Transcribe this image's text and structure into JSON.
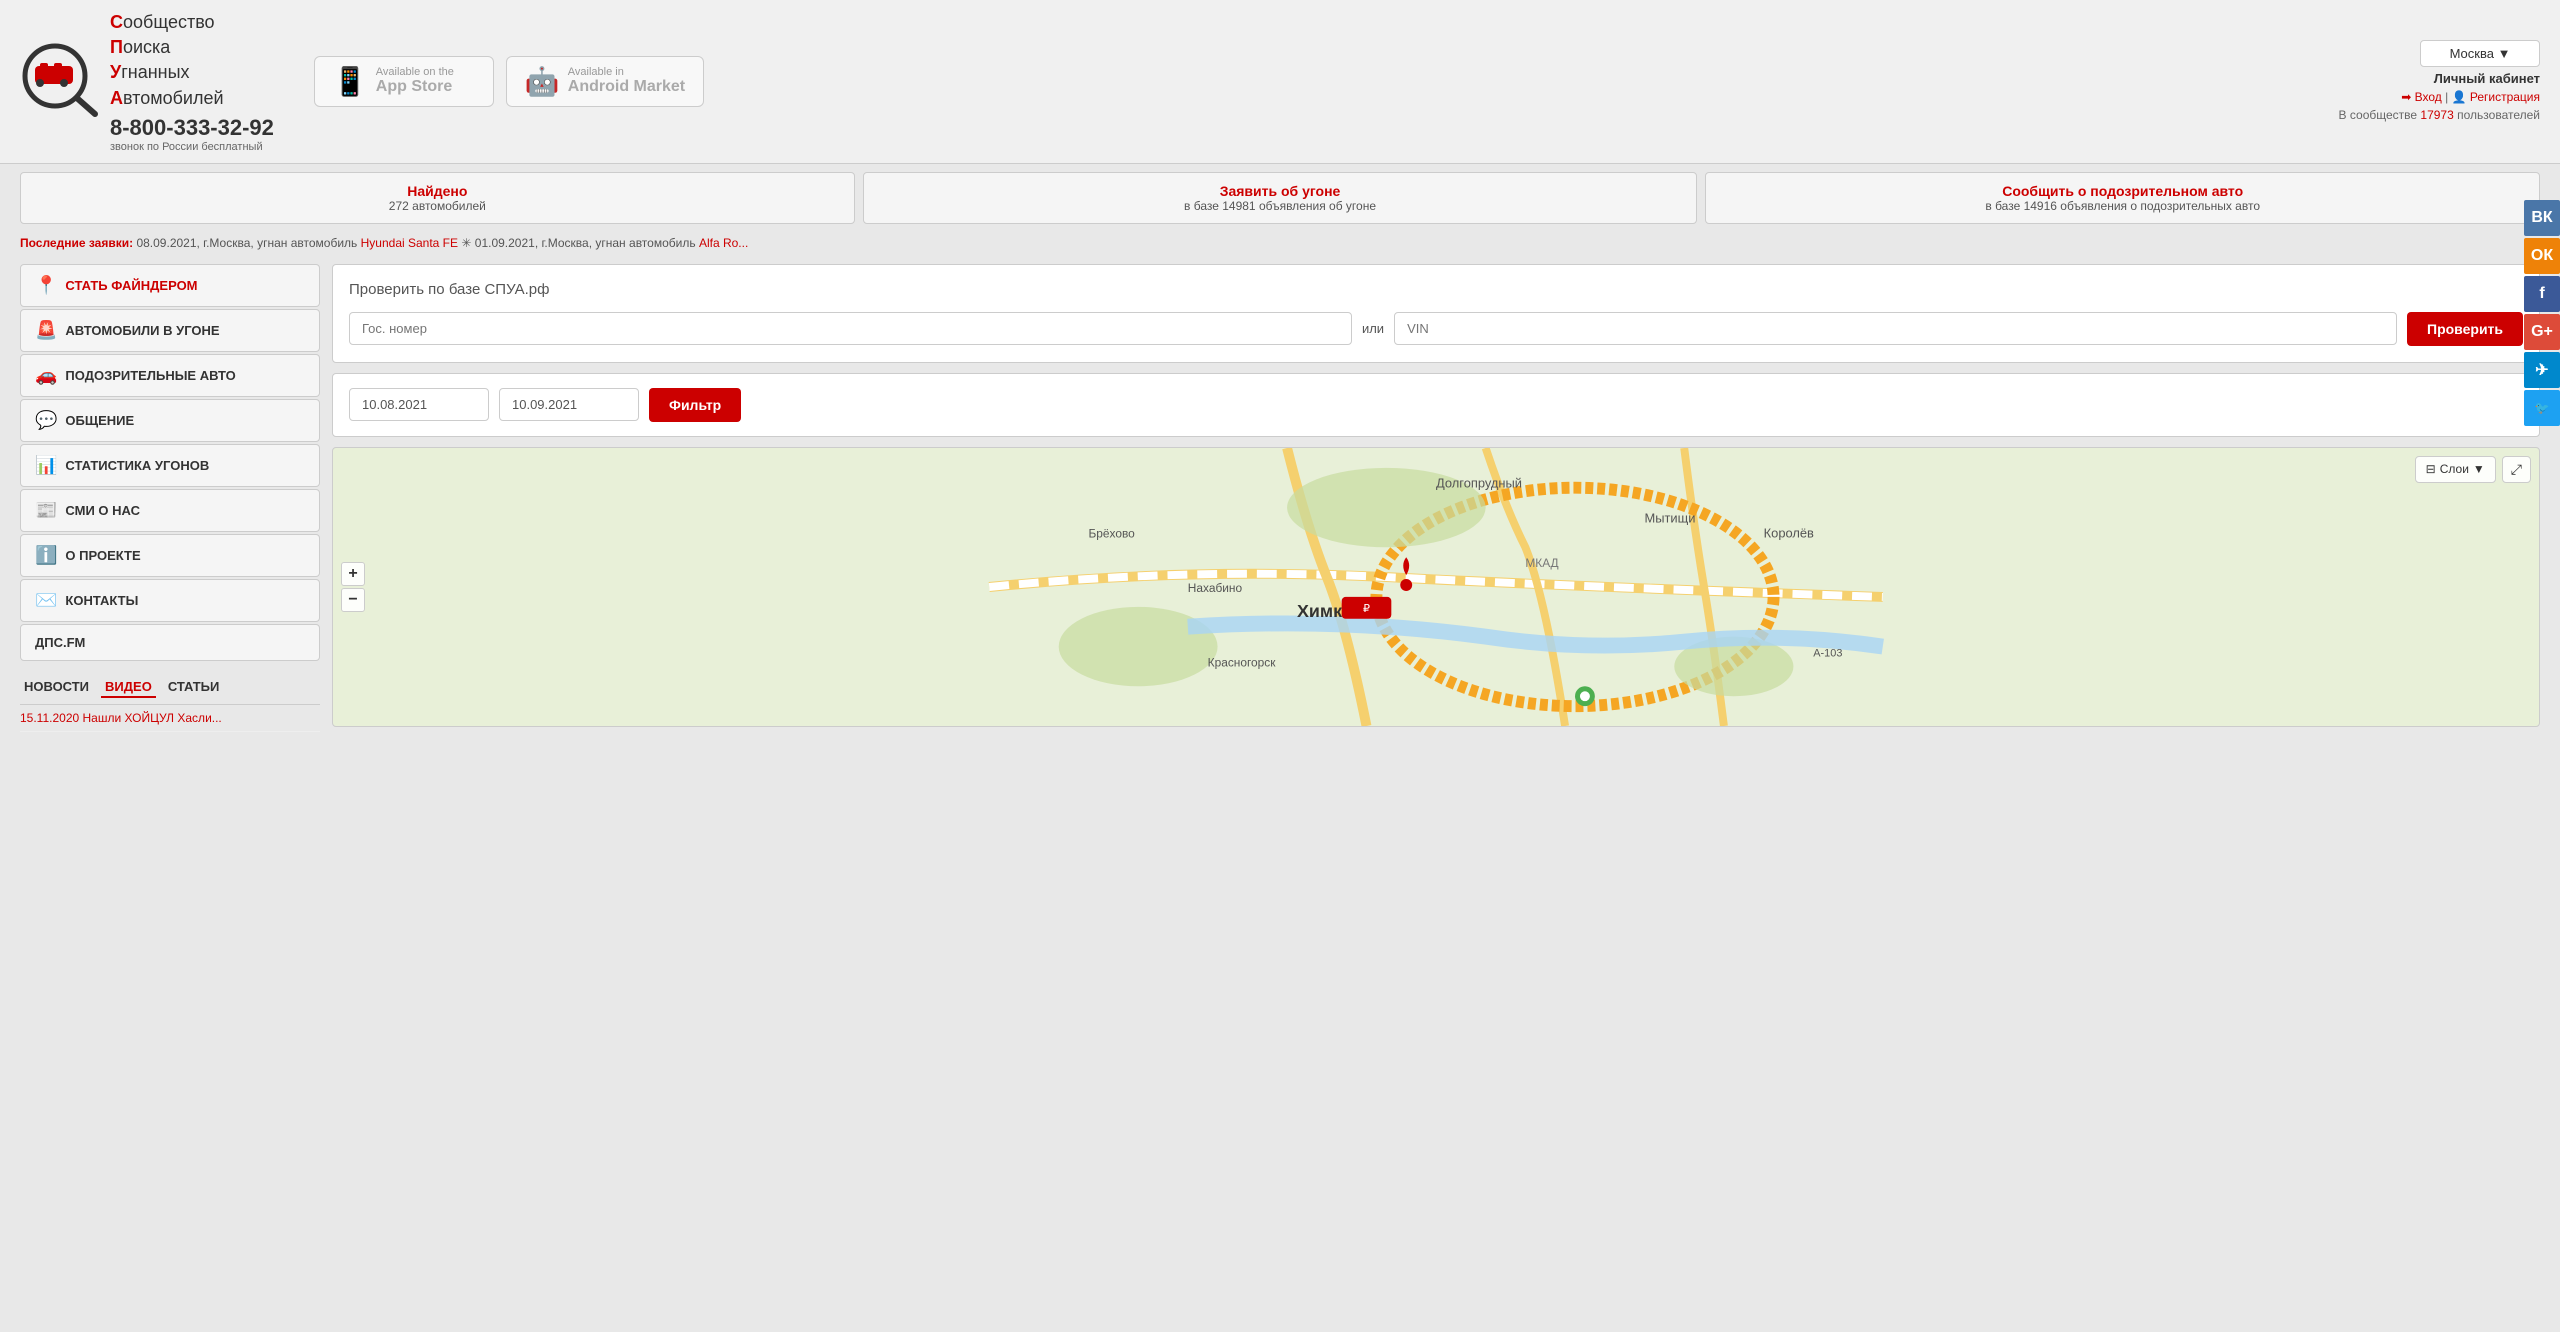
{
  "header": {
    "logo_alt": "СПУА Logo",
    "brand_line1": "С",
    "brand_rest1": "ообщество",
    "brand_line2": "П",
    "brand_rest2": "оиска",
    "brand_line3": "У",
    "brand_rest3": "гнанных",
    "brand_line4": "А",
    "brand_rest4": "втомобилей",
    "phone": "8-800-333-32-92",
    "phone_note": "звонок по России бесплатный",
    "app_store_top": "Available on the",
    "app_store_bottom": "App Store",
    "android_top": "Available in",
    "android_bottom": "Android Market",
    "city": "Москва",
    "personal_area": "Личный кабинет",
    "login": "Вход",
    "register": "Регистрация",
    "community_text": "В сообществе",
    "community_count": "17973",
    "community_suffix": "пользователей"
  },
  "stats": {
    "found_title": "Найдено",
    "found_value": "272 автомобилей",
    "report_title": "Заявить об угоне",
    "report_sub": "в базе 14981 объявления об угоне",
    "suspicious_title": "Сообщить о подозрительном авто",
    "suspicious_sub": "в базе 14916 объявления о подозрительных авто"
  },
  "ticker": {
    "label": "Последние заявки:",
    "text1": "08.09.2021, г.Москва, угнан автомобиль",
    "car1": "Hyundai Santa FE",
    "sep": "✳",
    "text2": "01.09.2021, г.Москва, угнан автомобиль",
    "car2": "Alfa Ro..."
  },
  "sidebar": {
    "items": [
      {
        "id": "finder",
        "icon": "📍",
        "label": "СТАТЬ ФАЙНДЕРОМ",
        "highlight": true
      },
      {
        "id": "stolen",
        "icon": "🚨",
        "label": "АВТОМОБИЛИ В УГОНЕ",
        "highlight": false
      },
      {
        "id": "suspicious",
        "icon": "🚗",
        "label": "ПОДОЗРИТЕЛЬНЫЕ АВТО",
        "highlight": false
      },
      {
        "id": "chat",
        "icon": "💬",
        "label": "ОБЩЕНИЕ",
        "highlight": false
      },
      {
        "id": "stats",
        "icon": "📊",
        "label": "СТАТИСТИКА УГОНОВ",
        "highlight": false
      },
      {
        "id": "media",
        "icon": "📰",
        "label": "СМИ О НАС",
        "highlight": false
      },
      {
        "id": "about",
        "icon": "ℹ️",
        "label": "О ПРОЕКТЕ",
        "highlight": false
      },
      {
        "id": "contacts",
        "icon": "✉️",
        "label": "КОНТАКТЫ",
        "highlight": false
      },
      {
        "id": "dps",
        "icon": "",
        "label": "ДПС.FM",
        "highlight": false
      }
    ],
    "news_tabs": [
      "НОВОСТИ",
      "ВИДЕО",
      "СТАТЬИ"
    ],
    "active_tab": "ВИДЕО",
    "news_item": "15.11.2020 Нашли ХОЙЦУЛ Хасли..."
  },
  "search": {
    "title": "Проверить по базе СПУА.рф",
    "plate_placeholder": "Гос. номер",
    "or_label": "или",
    "vin_placeholder": "VIN",
    "check_btn": "Проверить"
  },
  "filter": {
    "date_from": "10.08.2021",
    "date_to": "10.09.2021",
    "filter_btn": "Фильтр"
  },
  "map": {
    "layers_label": "Слои",
    "zoom_in": "+",
    "zoom_out": "−",
    "places": [
      "Брёхово",
      "Долгопрудный",
      "Мытищи",
      "Королёв",
      "Нахабино",
      "Химки",
      "Красногорск",
      "МКАД",
      "А-103"
    ],
    "marker_color": "#cc0000",
    "marker2_color": "#4CAF50"
  },
  "social": {
    "vk": "ВК",
    "ok": "ОК",
    "fb": "f",
    "gp": "G+",
    "tg": "✈",
    "tw": "🐦"
  }
}
